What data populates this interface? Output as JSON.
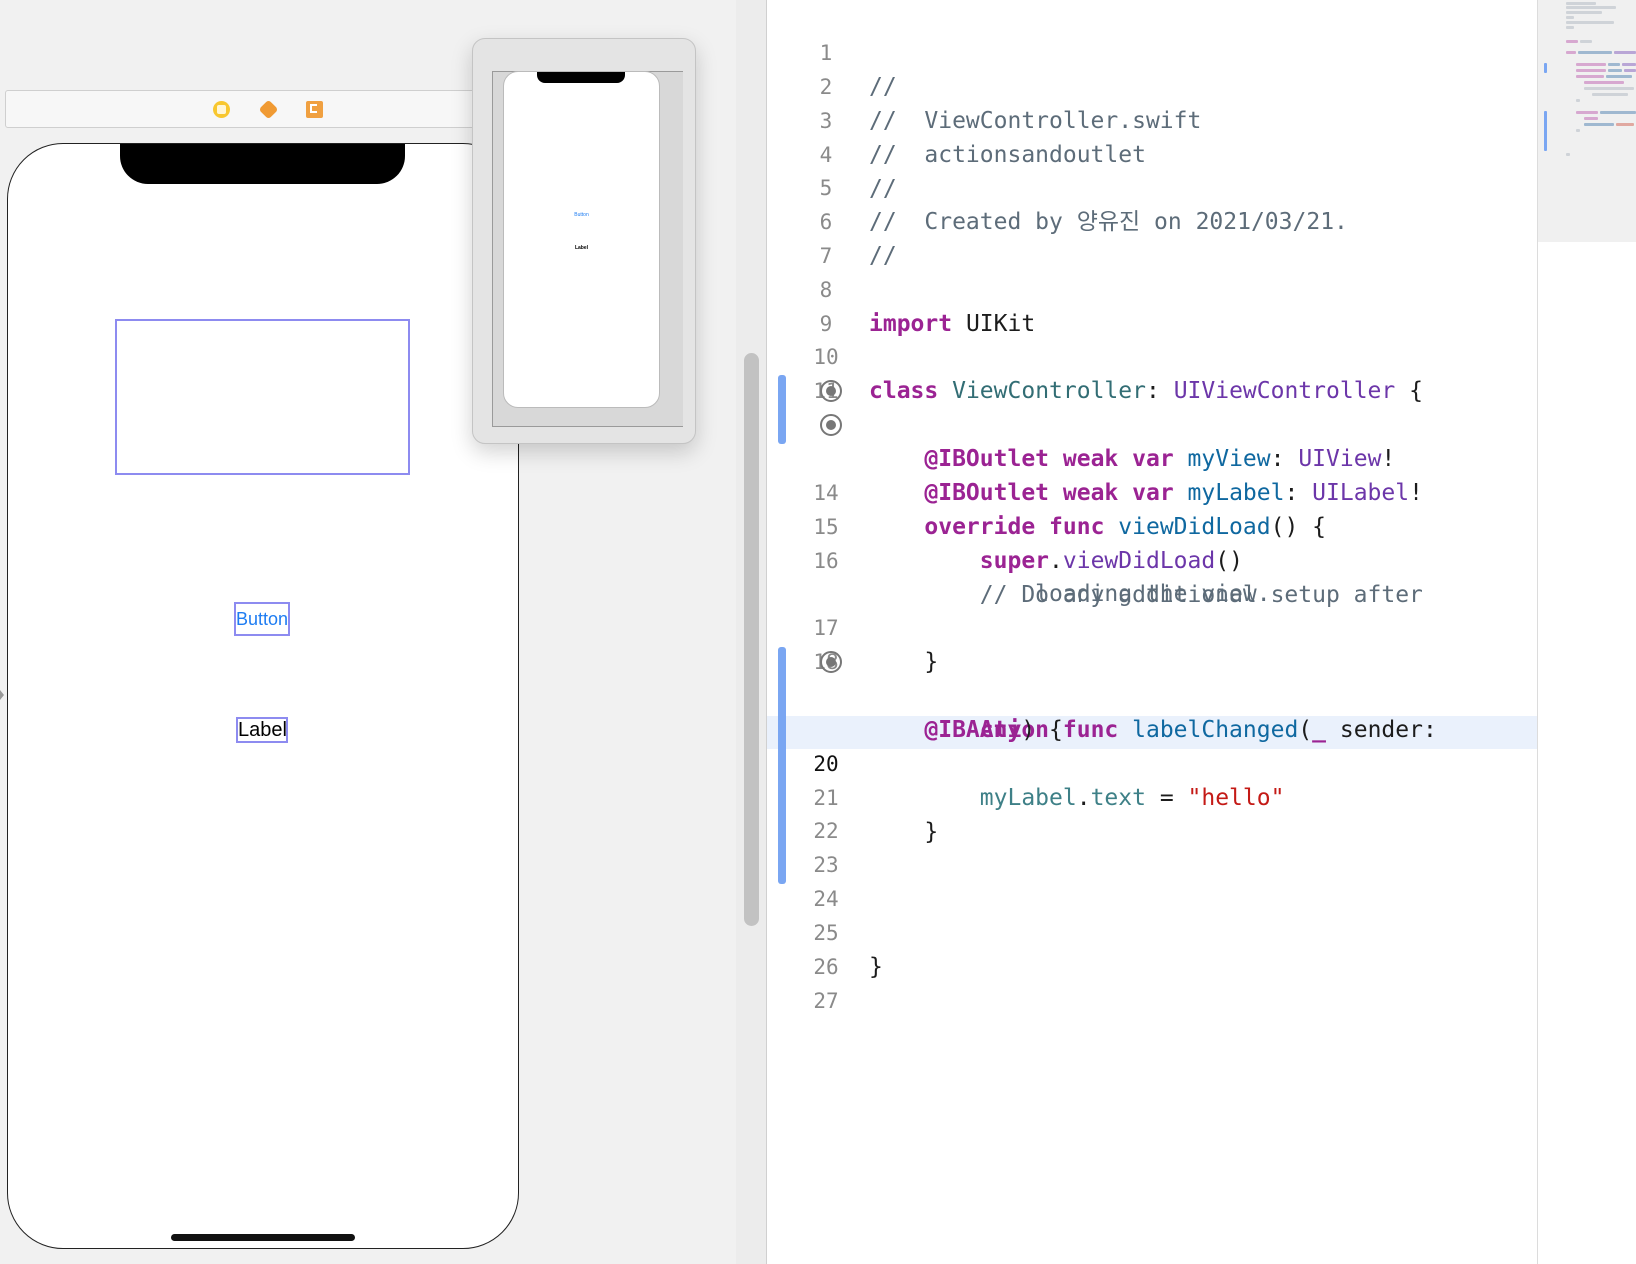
{
  "storyboard": {
    "scene_dock_icons": [
      "view-controller-icon",
      "first-responder-icon",
      "exit-icon"
    ],
    "button_title": "Button",
    "label_text": "Label",
    "preview": {
      "button_title": "Button",
      "label_text": "Label"
    }
  },
  "editor": {
    "current_line": "20",
    "lines": [
      {
        "n": "1",
        "text": "//"
      },
      {
        "n": "2",
        "text": "//  ViewController.swift"
      },
      {
        "n": "3",
        "text": "//  actionsandoutlet"
      },
      {
        "n": "4",
        "text": "//"
      },
      {
        "n": "5",
        "text": "//  Created by 양유진 on 2021/03/21."
      },
      {
        "n": "6",
        "text": "//"
      },
      {
        "n": "7",
        "text": ""
      },
      {
        "n": "8",
        "text": "import UIKit"
      },
      {
        "n": "9",
        "text": ""
      },
      {
        "n": "10",
        "text": "class ViewController: UIViewController {"
      },
      {
        "n": "11",
        "text": ""
      },
      {
        "n": "",
        "text": "    @IBOutlet weak var myView: UIView!"
      },
      {
        "n": "",
        "text": "    @IBOutlet weak var myLabel: UILabel!"
      },
      {
        "n": "14",
        "text": "    override func viewDidLoad() {"
      },
      {
        "n": "15",
        "text": "        super.viewDidLoad()"
      },
      {
        "n": "16",
        "text": "        // Do any additional setup after"
      },
      {
        "n": "",
        "text": "            loading the view."
      },
      {
        "n": "17",
        "text": "    }"
      },
      {
        "n": "18",
        "text": ""
      },
      {
        "n": "",
        "text": "    @IBAction func labelChanged(_ sender:"
      },
      {
        "n": "",
        "text": "        Any) {"
      },
      {
        "n": "20",
        "text": "        myLabel.text = \"hello\""
      },
      {
        "n": "21",
        "text": "    }"
      },
      {
        "n": "22",
        "text": ""
      },
      {
        "n": "23",
        "text": ""
      },
      {
        "n": "24",
        "text": ""
      },
      {
        "n": "25",
        "text": "}"
      },
      {
        "n": "26",
        "text": ""
      },
      {
        "n": "27",
        "text": ""
      }
    ],
    "code_tokens": {
      "comment_header": [
        "//",
        "//  ViewController.swift",
        "//  actionsandoutlet",
        "//",
        "//  Created by 양유진 on 2021/03/21.",
        "//"
      ],
      "import_kw": "import",
      "import_module": "UIKit",
      "class_kw": "class",
      "class_name": "ViewController",
      "superclass": "UIViewController",
      "outlet_attr": "@IBOutlet",
      "weak_kw": "weak",
      "var_kw": "var",
      "outlet1_name": "myView",
      "outlet1_type": "UIView",
      "outlet2_name": "myLabel",
      "outlet2_type": "UILabel",
      "override_kw": "override",
      "func_kw": "func",
      "vdl_name": "viewDidLoad",
      "super_kw": "super",
      "comment_setup_1": "// Do any additional setup after",
      "comment_setup_2": "loading the view.",
      "action_attr": "@IBAction",
      "action_name": "labelChanged",
      "underscore": "_",
      "sender": "sender",
      "any_kw": "Any",
      "text_prop": "text",
      "hello_str": "\"hello\""
    },
    "colors": {
      "keyword": "#9b2393",
      "comment": "#5d6c79",
      "type": "#6c36a9",
      "string": "#c41a16",
      "change_bar": "#7aa6f2",
      "current_line": "#eaf1fc"
    }
  }
}
